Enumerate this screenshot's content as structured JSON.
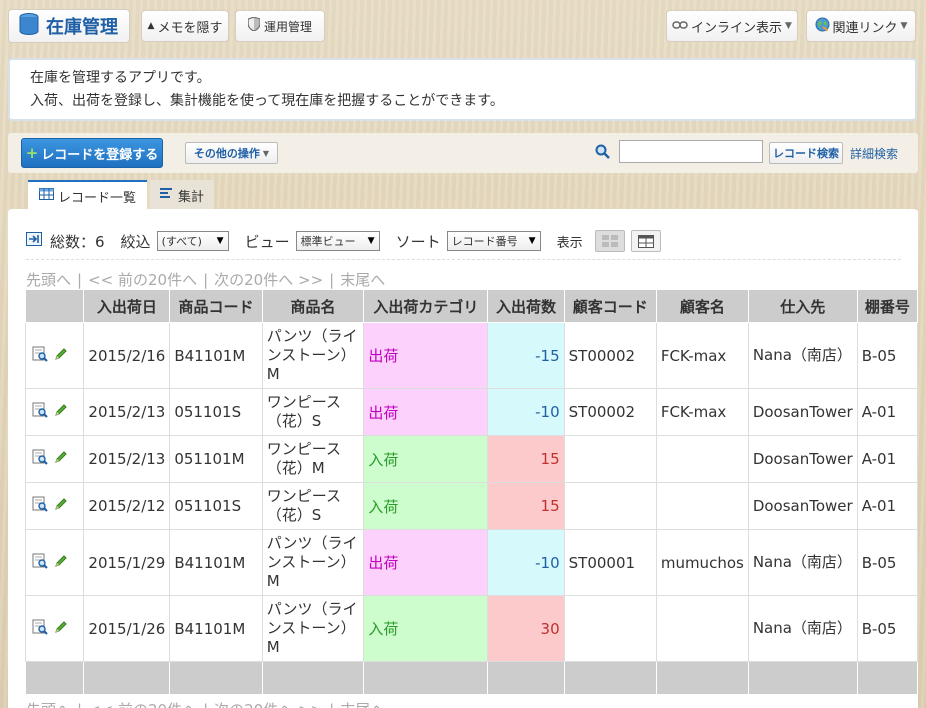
{
  "header": {
    "app_title": "在庫管理",
    "memo_button": "メモを隠す",
    "admin_button": "運用管理",
    "inline_button": "インライン表示",
    "links_button": "関連リンク"
  },
  "description": {
    "line1": "在庫を管理するアプリです。",
    "line2": "入荷、出荷を登録し、集計機能を使って現在庫を把握することができます。"
  },
  "toolbar": {
    "add_record": "レコードを登録する",
    "other_ops": "その他の操作",
    "search_value": "",
    "record_search": "レコード検索",
    "advanced_search": "詳細検索"
  },
  "tabs": {
    "list": "レコード一覧",
    "summary": "集計"
  },
  "viewbar": {
    "total_label": "総数：6",
    "filter_label": "絞込",
    "filter_value": "(すべて)",
    "view_label": "ビュー",
    "view_value": "標準ビュー",
    "sort_label": "ソート",
    "sort_value": "レコード番号",
    "display_label": "表示"
  },
  "pager": {
    "first": "先頭へ",
    "prev": "<< 前の20件へ",
    "next": "次の20件へ >>",
    "last": "末尾へ"
  },
  "table": {
    "headers": [
      "入出荷日",
      "商品コード",
      "商品名",
      "入出荷カテゴリ",
      "入出荷数",
      "顧客コード",
      "顧客名",
      "仕入先",
      "棚番号"
    ],
    "rows": [
      {
        "date": "2015/2/16",
        "code": "B41101M",
        "name": "パンツ（ラインストーン）M",
        "category": "出荷",
        "qty": "-15",
        "customer_code": "ST00002",
        "customer": "FCK-max",
        "supplier": "Nana（南店）",
        "shelf": "B-05"
      },
      {
        "date": "2015/2/13",
        "code": "051101S",
        "name": "ワンピース（花）S",
        "category": "出荷",
        "qty": "-10",
        "customer_code": "ST00002",
        "customer": "FCK-max",
        "supplier": "DoosanTower",
        "shelf": "A-01"
      },
      {
        "date": "2015/2/13",
        "code": "051101M",
        "name": "ワンピース（花）M",
        "category": "入荷",
        "qty": "15",
        "customer_code": "",
        "customer": "",
        "supplier": "DoosanTower",
        "shelf": "A-01"
      },
      {
        "date": "2015/2/12",
        "code": "051101S",
        "name": "ワンピース（花）S",
        "category": "入荷",
        "qty": "15",
        "customer_code": "",
        "customer": "",
        "supplier": "DoosanTower",
        "shelf": "A-01"
      },
      {
        "date": "2015/1/29",
        "code": "B41101M",
        "name": "パンツ（ラインストーン）M",
        "category": "出荷",
        "qty": "-10",
        "customer_code": "ST00001",
        "customer": "mumuchos",
        "supplier": "Nana（南店）",
        "shelf": "B-05"
      },
      {
        "date": "2015/1/26",
        "code": "B41101M",
        "name": "パンツ（ラインストーン）M",
        "category": "入荷",
        "qty": "30",
        "customer_code": "",
        "customer": "",
        "supplier": "Nana（南店）",
        "shelf": "B-05"
      }
    ]
  },
  "colors": {
    "accent": "#1f70c0",
    "shipment_bg": "#fcd2fc",
    "receipt_bg": "#cdfccd",
    "negative_qty_bg": "#d6fafc",
    "positive_qty_bg": "#fccaca"
  }
}
